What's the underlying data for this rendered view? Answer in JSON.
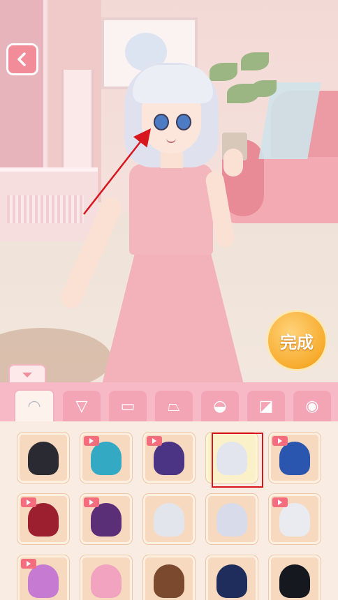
{
  "app": {
    "done_label": "完成",
    "colors": {
      "accent_pink": "#f28c98",
      "done_orange": "#f7ac2e",
      "category_bar": "#f7b9c5",
      "annotation_red": "#d7161f"
    }
  },
  "categories": [
    {
      "id": "hair",
      "icon": "hair-icon",
      "active": true
    },
    {
      "id": "dress",
      "icon": "dress-icon",
      "active": false
    },
    {
      "id": "top",
      "icon": "shirt-icon",
      "active": false
    },
    {
      "id": "skirt",
      "icon": "skirt-icon",
      "active": false
    },
    {
      "id": "shoes",
      "icon": "shoes-icon",
      "active": false
    },
    {
      "id": "socks",
      "icon": "socks-icon",
      "active": false
    },
    {
      "id": "face",
      "icon": "face-icon",
      "active": false
    }
  ],
  "hair_items": [
    {
      "color": "#2a2a33",
      "video": false,
      "selected": false
    },
    {
      "color": "#33a9c4",
      "video": true,
      "selected": false
    },
    {
      "color": "#4a3483",
      "video": true,
      "selected": false
    },
    {
      "color": "#e2e4ee",
      "video": false,
      "selected": true
    },
    {
      "color": "#2a56b0",
      "video": true,
      "selected": false
    },
    {
      "color": "#9c1f2f",
      "video": true,
      "selected": false
    },
    {
      "color": "#5a2f78",
      "video": true,
      "selected": false
    },
    {
      "color": "#e3e5ec",
      "video": false,
      "selected": false
    },
    {
      "color": "#d8dcea",
      "video": false,
      "selected": false
    },
    {
      "color": "#e9ebf1",
      "video": true,
      "selected": false
    },
    {
      "color": "#c77ad2",
      "video": true,
      "selected": false
    },
    {
      "color": "#f2a3bf",
      "video": false,
      "selected": false
    },
    {
      "color": "#7b4a2e",
      "video": false,
      "selected": false
    },
    {
      "color": "#1f2d5c",
      "video": false,
      "selected": false
    },
    {
      "color": "#16181f",
      "video": false,
      "selected": false
    }
  ]
}
